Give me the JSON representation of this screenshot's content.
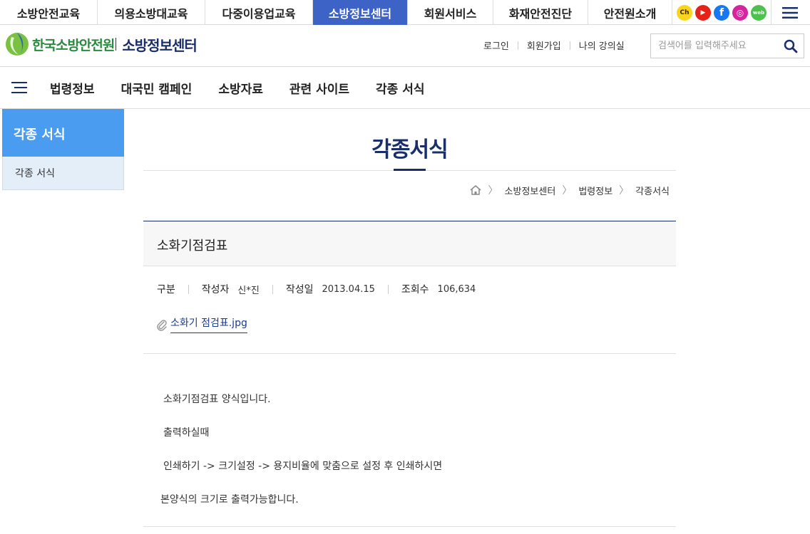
{
  "top_tabs": [
    {
      "label": "소방안전교육"
    },
    {
      "label": "의용소방대교육"
    },
    {
      "label": "다중이용업교육"
    },
    {
      "label": "소방정보센터",
      "active": true
    },
    {
      "label": "회원서비스"
    },
    {
      "label": "화재안전진단"
    },
    {
      "label": "안전원소개"
    }
  ],
  "social": [
    {
      "name": "kakao-channel-icon",
      "text": "Ch",
      "color": "#f9d41c"
    },
    {
      "name": "youtube-icon",
      "text": "▶",
      "color": "#e62117"
    },
    {
      "name": "facebook-icon",
      "text": "f",
      "color": "#1877f2"
    },
    {
      "name": "instagram-icon",
      "text": "◎",
      "color": "#d6249f"
    },
    {
      "name": "webzine-icon",
      "text": "web",
      "color": "#4cc14c"
    }
  ],
  "header": {
    "logo_text": "한국소방안전원",
    "logo_sub": "소방정보센터",
    "util_links": [
      "로그인",
      "회원가입",
      "나의 강의실"
    ],
    "search_placeholder": "검색어를 입력해주세요"
  },
  "nav": {
    "items": [
      "법령정보",
      "대국민 캠페인",
      "소방자료",
      "관련 사이트",
      "각종 서식"
    ]
  },
  "sidebar": {
    "title": "각종 서식",
    "items": [
      "각종 서식"
    ]
  },
  "page": {
    "title": "각종서식",
    "breadcrumb": [
      "소방정보센터",
      "법령정보",
      "각종서식"
    ]
  },
  "post": {
    "title": "소화기점검표",
    "meta": {
      "category_label": "구분",
      "author_label": "작성자",
      "author": "신*진",
      "date_label": "작성일",
      "date": "2013.04.15",
      "views_label": "조회수",
      "views": "106,634"
    },
    "attachment": "소화기 점검표.jpg",
    "body": [
      "소화기점검표 양식입니다.",
      "출력하실때",
      "인쇄하기 -> 크기설정 -> 용지비율에 맞춤으로 설정 후 인쇄하시면",
      "본양식의 크기로 출력가능합니다."
    ]
  }
}
